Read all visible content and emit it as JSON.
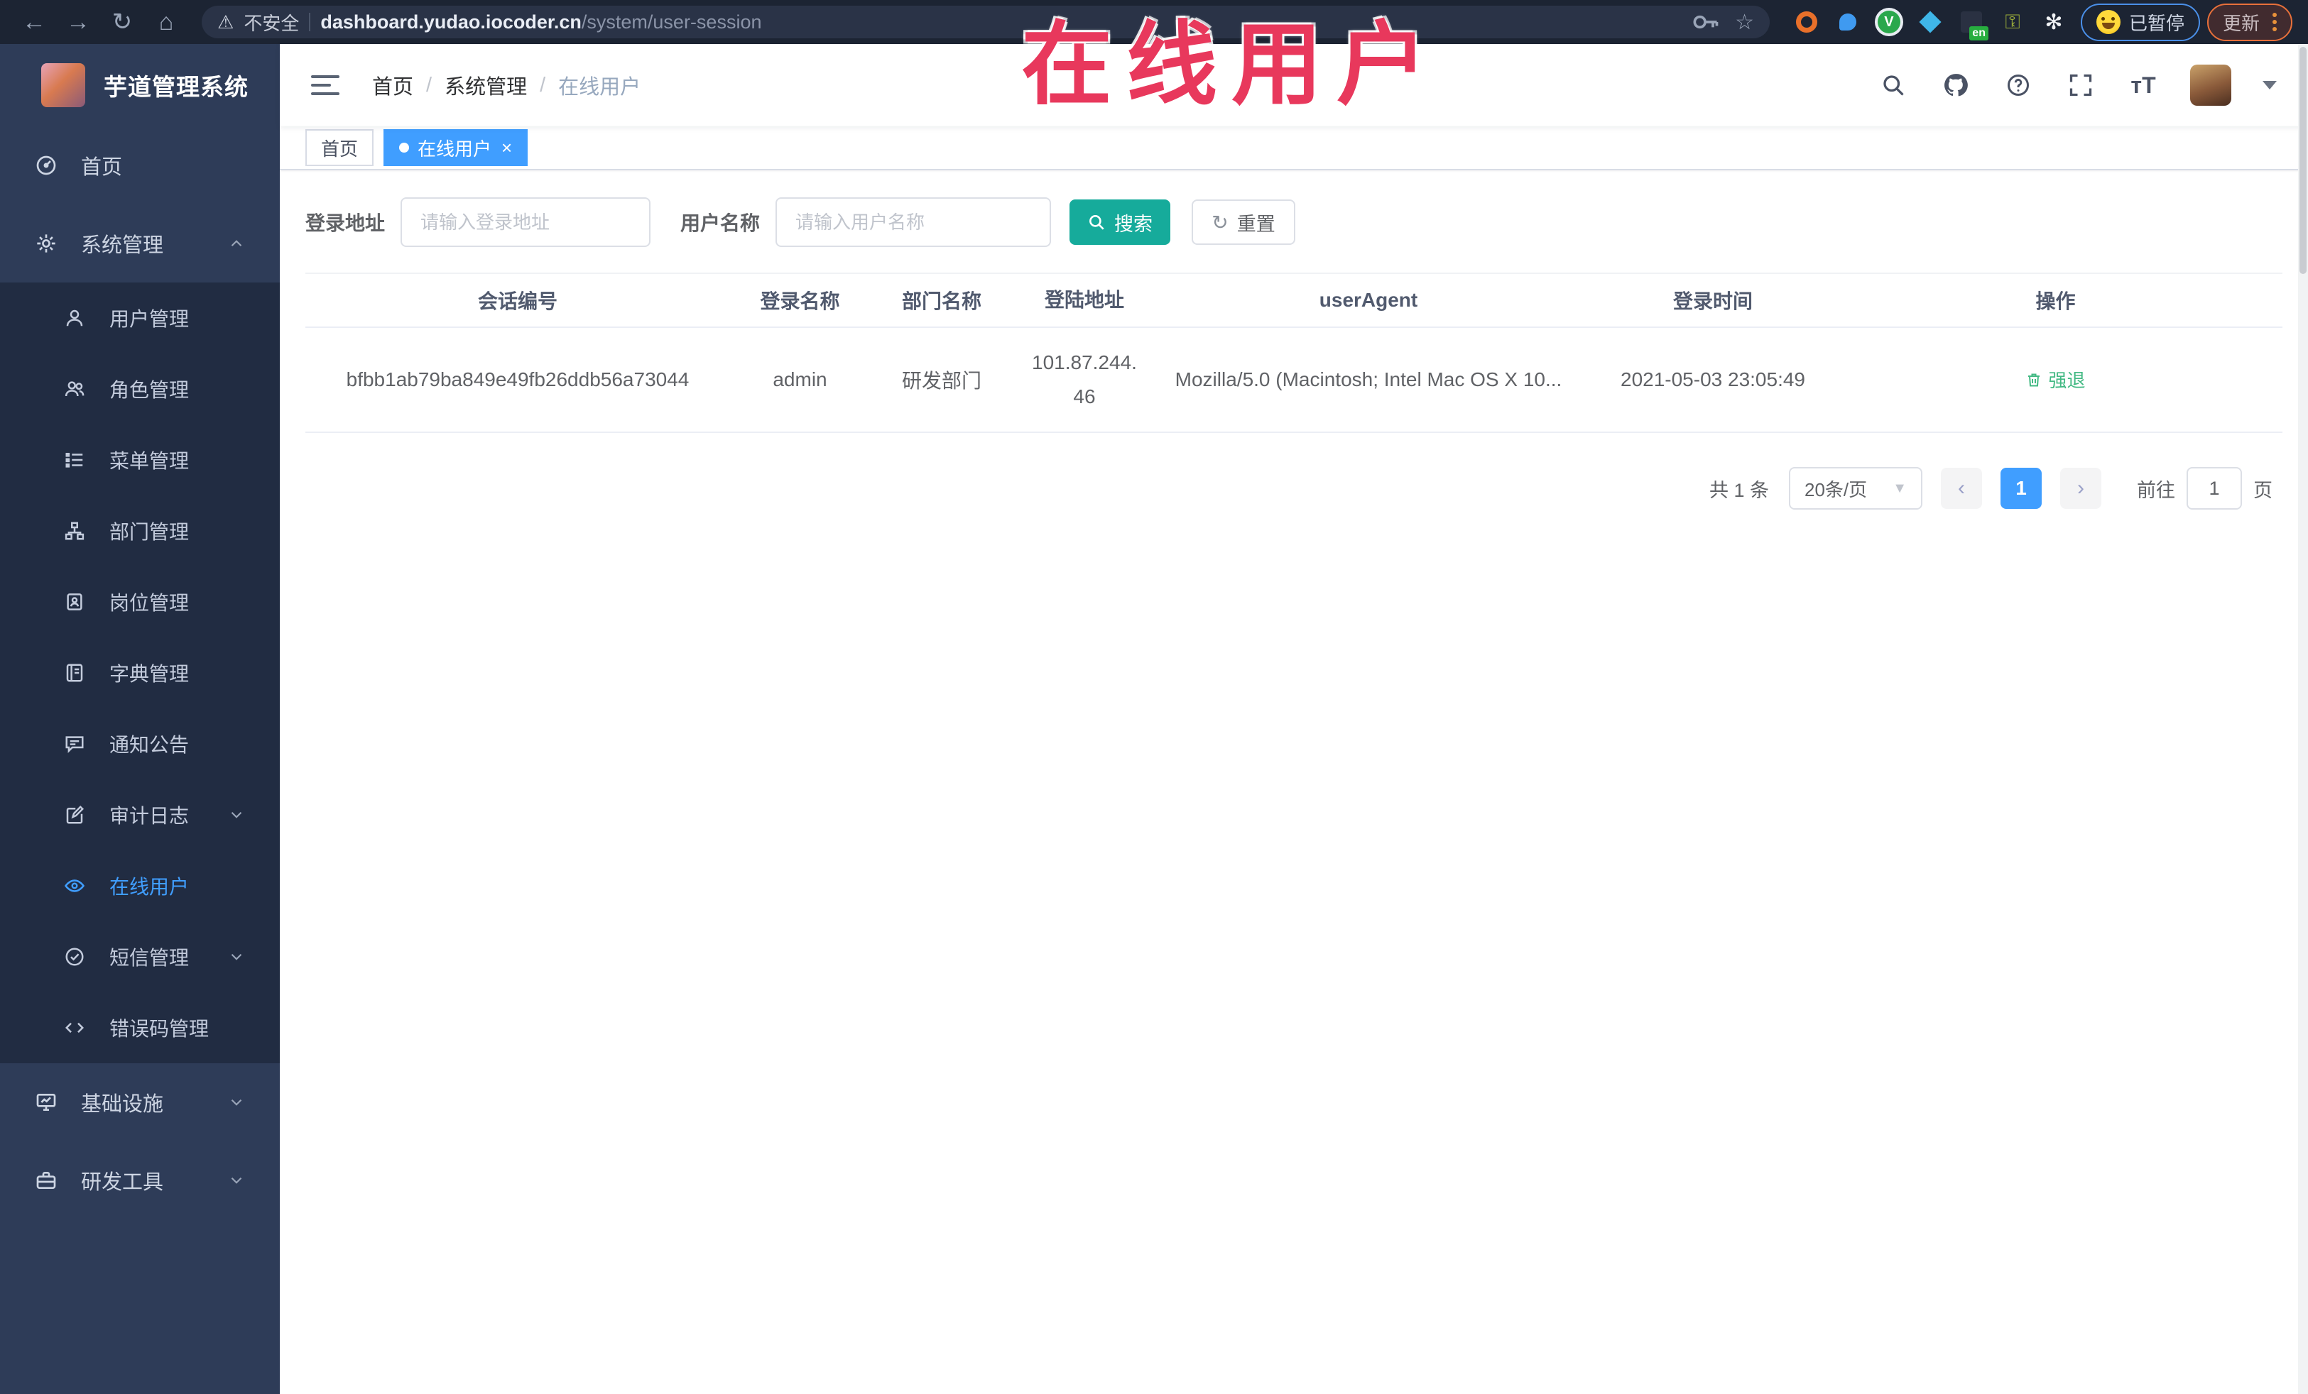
{
  "browser": {
    "security_label": "不安全",
    "url_domain": "dashboard.yudao.iocoder.cn",
    "url_path": "/system/user-session",
    "paused_badge": "已暂停",
    "update_button": "更新",
    "extension_icons": [
      "key-icon",
      "star-icon",
      "orange-ring-icon",
      "blue-drop-icon",
      "green-v-icon",
      "blue-diamond-icon",
      "translate-en-icon",
      "green-key-icon",
      "white-flower-icon"
    ]
  },
  "overlay": {
    "title": "在线用户"
  },
  "sidebar": {
    "app_title": "芋道管理系统",
    "home": {
      "label": "首页"
    },
    "system": {
      "label": "系统管理"
    },
    "submenu": [
      {
        "label": "用户管理"
      },
      {
        "label": "角色管理"
      },
      {
        "label": "菜单管理"
      },
      {
        "label": "部门管理"
      },
      {
        "label": "岗位管理"
      },
      {
        "label": "字典管理"
      },
      {
        "label": "通知公告"
      },
      {
        "label": "审计日志"
      },
      {
        "label": "在线用户"
      },
      {
        "label": "短信管理"
      },
      {
        "label": "错误码管理"
      }
    ],
    "bottom": [
      {
        "label": "基础设施"
      },
      {
        "label": "研发工具"
      }
    ]
  },
  "header": {
    "breadcrumb": [
      "首页",
      "系统管理",
      "在线用户"
    ]
  },
  "tabs": [
    {
      "label": "首页"
    },
    {
      "label": "在线用户",
      "close": "×"
    }
  ],
  "filters": {
    "login_address_label": "登录地址",
    "login_address_placeholder": "请输入登录地址",
    "username_label": "用户名称",
    "username_placeholder": "请输入用户名称",
    "search_button": "搜索",
    "reset_button": "重置"
  },
  "table": {
    "columns": [
      "会话编号",
      "登录名称",
      "部门名称",
      "登陆地址",
      "userAgent",
      "登录时间",
      "操作"
    ],
    "rows": [
      {
        "session_id": "bfbb1ab79ba849e49fb26ddb56a73044",
        "username": "admin",
        "dept": "研发部门",
        "ip_line1": "101.87.244.",
        "ip_line2": "46",
        "user_agent": "Mozilla/5.0 (Macintosh; Intel Mac OS X 10...",
        "login_time": "2021-05-03 23:05:49",
        "action": "强退"
      }
    ]
  },
  "pagination": {
    "total": "共 1 条",
    "page_size": "20条/页",
    "prev": "‹",
    "next": "›",
    "current_page": "1",
    "goto_label": "前往",
    "goto_value": "1",
    "goto_suffix": "页"
  },
  "colors": {
    "accent": "#409eff",
    "sidebar_bg": "#2e3c58",
    "submenu_bg": "#212c42",
    "search_button": "#16ab9b",
    "action_link": "#42b983",
    "overlay_red": "#e8385c",
    "tab_active": "#409eff"
  }
}
